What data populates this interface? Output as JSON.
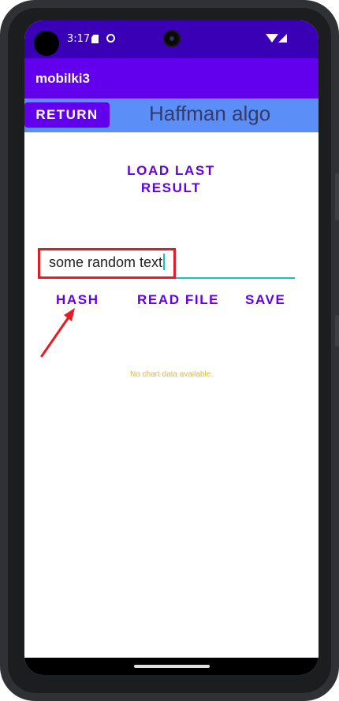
{
  "status_bar": {
    "time": "3:17",
    "icons": [
      "sd-card-icon",
      "data-saver-icon",
      "wifi-icon",
      "signal-icon"
    ]
  },
  "app_bar": {
    "title": "mobilki3"
  },
  "header": {
    "return_label": "RETURN",
    "title": "Haffman algo"
  },
  "main": {
    "load_last_label_line1": "LOAD LAST",
    "load_last_label_line2": "RESULT",
    "input_value": "some random text",
    "actions": {
      "hash_label": "HASH",
      "read_file_label": "READ FILE",
      "save_label": "SAVE"
    },
    "chart_placeholder": "No chart data available."
  },
  "colors": {
    "status_bar": "#3a00b5",
    "app_bar": "#6200ee",
    "header_row": "#5c8ef7",
    "accent_text": "#6200ee",
    "input_underline": "#14c3be",
    "highlight": "#e81b24",
    "placeholder_text": "#d9b93c"
  }
}
